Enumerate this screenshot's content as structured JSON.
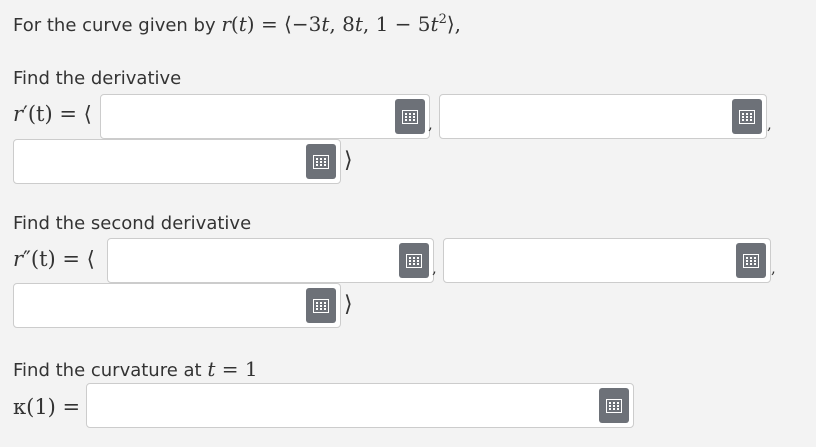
{
  "intro": {
    "prefix": "For the curve given by ",
    "r": "r",
    "t": "t",
    "eq_open": "(",
    "eq_close": ") = ⟨−3",
    "t2": "t",
    "mid": ", 8",
    "t3": "t",
    "tail": ", 1 − 5",
    "t4": "t",
    "sq": "2",
    "end": "⟩,"
  },
  "sections": {
    "first": {
      "heading": "Find the derivative",
      "label_r": "r",
      "label_rest": "′(t) = ⟨",
      "separator": ",",
      "close": "⟩",
      "fields": [
        "",
        "",
        ""
      ]
    },
    "second": {
      "heading": "Find the second derivative",
      "label_r": "r",
      "label_rest": "″(t) = ⟨",
      "separator": ",",
      "close": "⟩",
      "fields": [
        "",
        "",
        ""
      ]
    },
    "third": {
      "heading_prefix": "Find the curvature at ",
      "heading_var": "t",
      "heading_eq": " = 1",
      "label": "κ(1) =",
      "fields": [
        ""
      ]
    }
  },
  "icons": {
    "keypad": "keypad-icon"
  },
  "colors": {
    "background": "#f3f3f3",
    "button": "#6d7178",
    "field_border": "#cccccc"
  }
}
